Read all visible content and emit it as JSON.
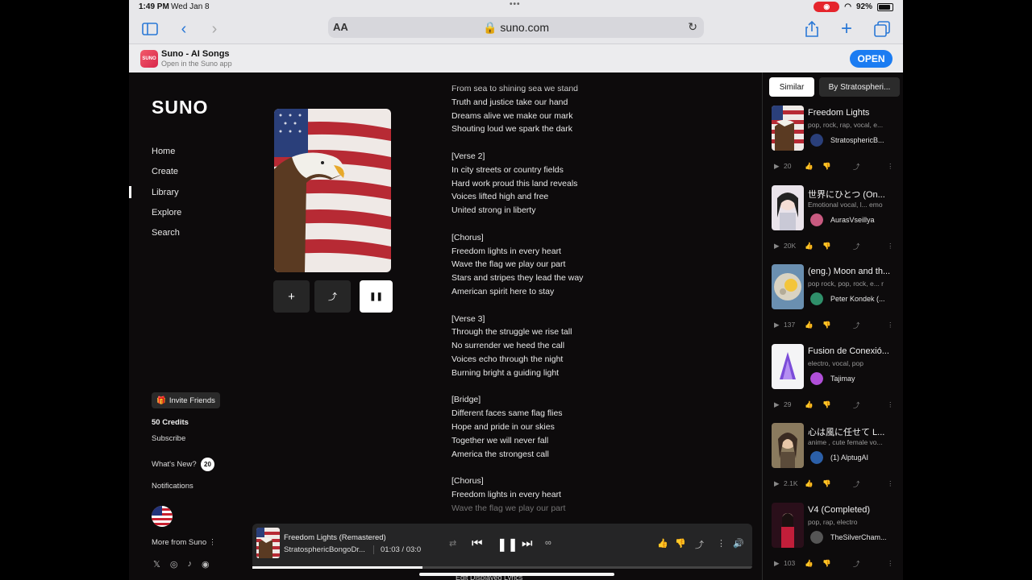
{
  "status": {
    "time": "1:49 PM",
    "date": "Wed Jan 8",
    "battery": "92%"
  },
  "browser": {
    "aa": "AA",
    "url": "suno.com"
  },
  "banner": {
    "app_name": "Suno - AI Songs",
    "app_sub": "Open in the Suno app",
    "open_label": "OPEN",
    "icon_text": "SUNO"
  },
  "logo": "SUNO",
  "nav": {
    "items": [
      "Home",
      "Create",
      "Library",
      "Explore",
      "Search"
    ],
    "active": "Library"
  },
  "sidebar": {
    "invite": "Invite Friends",
    "credits": "50 Credits",
    "subscribe": "Subscribe",
    "whats_new": "What's New?",
    "whats_new_count": "20",
    "notifications": "Notifications",
    "more": "More from Suno"
  },
  "lyrics": [
    "From sea to shining sea we stand",
    "Truth and justice take our hand",
    "Dreams alive we make our mark",
    "Shouting loud we spark the dark",
    "",
    "[Verse 2]",
    "In city streets or country fields",
    "Hard work proud this land reveals",
    "Voices lifted high and free",
    "United strong in liberty",
    "",
    "[Chorus]",
    "Freedom lights in every heart",
    "Wave the flag we play our part",
    "Stars and stripes they lead the way",
    "American spirit here to stay",
    "",
    "[Verse 3]",
    "Through the struggle we rise tall",
    "No surrender we heed the call",
    "Voices echo through the night",
    "Burning bright a guiding light",
    "",
    "[Bridge]",
    "Different faces same flag flies",
    "Hope and pride in our skies",
    "Together we will never fall",
    "America the strongest call",
    "",
    "[Chorus]",
    "Freedom lights in every heart",
    "Wave the flag we play our part"
  ],
  "panel": {
    "tabs": [
      "Similar",
      "By Stratospheri..."
    ],
    "songs": [
      {
        "title": "Freedom Lights",
        "tags": "pop, rock, rap, vocal, e...",
        "artist": "StratosphericB...",
        "plays": "20",
        "art": "flag"
      },
      {
        "title": "世界にひとつ (On...",
        "tags": "Emotional vocal, l... emo",
        "artist": "AurasVseillya",
        "plays": "20K",
        "art": "anime"
      },
      {
        "title": "(eng.) Moon and th...",
        "tags": "pop rock, pop, rock, e... r",
        "artist": "Peter Kondek (...",
        "plays": "137",
        "art": "moon"
      },
      {
        "title": "Fusion de Conexió...",
        "tags": "electro, vocal, pop",
        "artist": "Tajimay",
        "plays": "29",
        "art": "logo"
      },
      {
        "title": "心は風に任せて L...",
        "tags": "anime , cute female vo...",
        "artist": "(1) AlptugAI",
        "plays": "2.1K",
        "art": "girl"
      },
      {
        "title": "V4 (Completed)",
        "tags": "pop, rap, electro",
        "artist": "TheSilverCham...",
        "plays": "103",
        "art": "stage"
      }
    ]
  },
  "player": {
    "title": "Freedom Lights (Remastered)",
    "artist": "StratosphericBongoDr...",
    "time": "01:03 / 03:0",
    "progress": 0.34
  },
  "edit_lyrics": "Edit Displayed Lyrics"
}
